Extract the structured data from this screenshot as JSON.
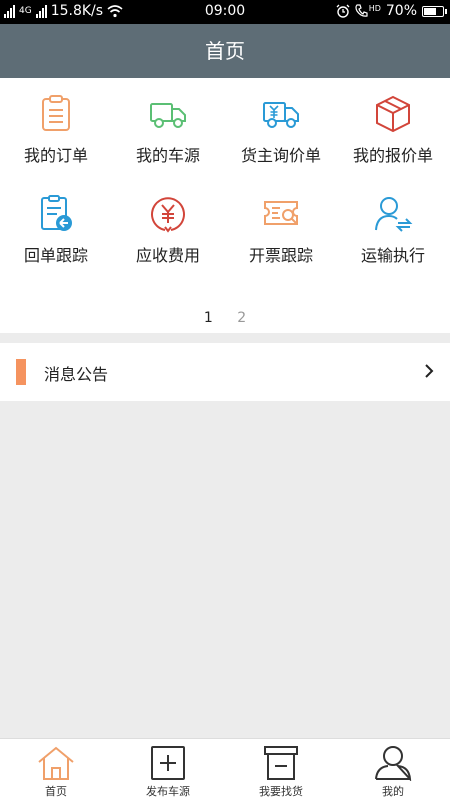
{
  "status": {
    "network": "4G",
    "speed": "15.8K/s",
    "time": "09:00",
    "hd": "HD",
    "battery": "70%",
    "battery_level": 0.7
  },
  "header": {
    "title": "首页"
  },
  "menu": [
    {
      "label": "我的订单",
      "icon": "clipboard-list-icon",
      "color": "#f0a06a"
    },
    {
      "label": "我的车源",
      "icon": "truck-icon",
      "color": "#5bbf74"
    },
    {
      "label": "货主询价单",
      "icon": "price-truck-icon",
      "color": "#2a9ad6"
    },
    {
      "label": "我的报价单",
      "icon": "package-box-icon",
      "color": "#d2453a"
    },
    {
      "label": "回单跟踪",
      "icon": "return-receipt-icon",
      "color": "#2a9ad6"
    },
    {
      "label": "应收费用",
      "icon": "yuan-coin-icon",
      "color": "#d2453a"
    },
    {
      "label": "开票跟踪",
      "icon": "invoice-ticket-icon",
      "color": "#f0a06a"
    },
    {
      "label": "运输执行",
      "icon": "user-transfer-icon",
      "color": "#2a9ad6"
    }
  ],
  "pager": {
    "pages": [
      "1",
      "2"
    ],
    "current": "1"
  },
  "notice": {
    "title": "消息公告"
  },
  "tabs": [
    {
      "label": "首页",
      "icon": "home-icon",
      "active": true
    },
    {
      "label": "发布车源",
      "icon": "plus-square-icon",
      "active": false
    },
    {
      "label": "我要找货",
      "icon": "box-icon",
      "active": false
    },
    {
      "label": "我的",
      "icon": "user-icon",
      "active": false
    }
  ],
  "colors": {
    "nav": "#5e6d76",
    "accent": "#f5935f"
  }
}
